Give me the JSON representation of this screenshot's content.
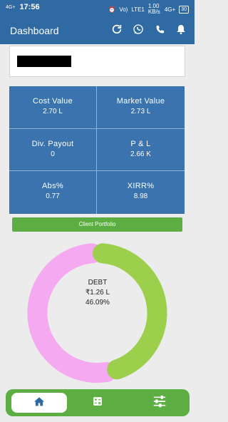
{
  "status_bar": {
    "time": "17:56",
    "network_left": "4G+",
    "network_right": "4G+",
    "volte": "Vo)",
    "lte": "LTE1",
    "speed": "1.00 KB/s",
    "battery": "30"
  },
  "app_bar": {
    "title": "Dashboard"
  },
  "metrics": [
    {
      "label": "Cost Value",
      "value": "2.70 L"
    },
    {
      "label": "Market Value",
      "value": "2.73 L"
    },
    {
      "label": "Div. Payout",
      "value": "0"
    },
    {
      "label": "P & L",
      "value": "2.66 K"
    },
    {
      "label": "Abs%",
      "value": "0.77"
    },
    {
      "label": "XIRR%",
      "value": "8.98"
    }
  ],
  "client_portfolio_label": "Client Portfolio",
  "donut": {
    "category": "DEBT",
    "amount": "₹1.26 L",
    "percent": "46.09%",
    "debt_fraction": 0.4609,
    "colors": {
      "debt": "#9ccf4b",
      "other": "#f5a9f0"
    }
  },
  "colors": {
    "primary": "#2f6aa3",
    "grid": "#3a73ad",
    "accent_green": "#5cae42"
  },
  "bottom_nav": {
    "items": [
      "home-icon",
      "calculator-icon",
      "sliders-icon"
    ]
  }
}
